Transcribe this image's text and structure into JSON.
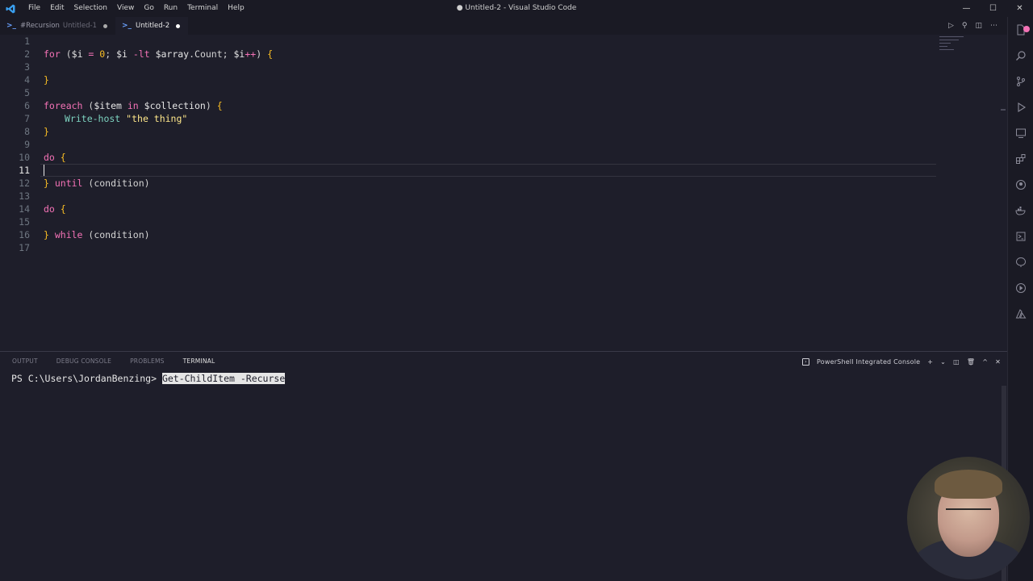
{
  "window": {
    "title": "● Untitled-2 - Visual Studio Code",
    "menu": [
      "File",
      "Edit",
      "Selection",
      "View",
      "Go",
      "Run",
      "Terminal",
      "Help"
    ],
    "controls": [
      "—",
      "☐",
      "✕"
    ]
  },
  "tabs": [
    {
      "icon": ">_",
      "label": "#Recursion",
      "sub": "Untitled-1",
      "active": false
    },
    {
      "icon": ">_",
      "label": "Untitled-2",
      "sub": "",
      "active": true
    }
  ],
  "editor": {
    "current_line": 11,
    "line_numbers": [
      "1",
      "2",
      "3",
      "4",
      "5",
      "6",
      "7",
      "8",
      "9",
      "10",
      "11",
      "12",
      "13",
      "14",
      "15",
      "16",
      "17"
    ]
  },
  "code": {
    "l2": {
      "kw": "for",
      "p1": " (",
      "v1": "$i",
      "op1": " = ",
      "n1": "0",
      "p2": "; ",
      "v2": "$i",
      "op2": " -lt ",
      "v3": "$array",
      "p3": ".Count; ",
      "v4": "$i",
      "op3": "++",
      "p4": ") ",
      "b1": "{"
    },
    "l4": {
      "b": "}"
    },
    "l6": {
      "kw": "foreach",
      "p1": " (",
      "v1": "$item",
      "kw2": " in ",
      "v2": "$collection",
      "p2": ") ",
      "b": "{"
    },
    "l7": {
      "fn": "Write-host",
      "s": " \"the thing\""
    },
    "l8": {
      "b": "}"
    },
    "l10": {
      "kw": "do",
      "b": " {"
    },
    "l12": {
      "b": "} ",
      "kw": "until",
      "rest": " (condition)"
    },
    "l14": {
      "kw": "do",
      "b": " {"
    },
    "l16": {
      "b": "} ",
      "kw": "while",
      "rest": " (condition)"
    }
  },
  "panel": {
    "tabs": [
      "OUTPUT",
      "DEBUG CONSOLE",
      "PROBLEMS",
      "TERMINAL"
    ],
    "active_tab": "TERMINAL",
    "terminal_name": "PowerShell Integrated Console",
    "actions": [
      "+",
      "⌄",
      "◫",
      "🗑",
      "^",
      "✕"
    ]
  },
  "terminal": {
    "prompt": "PS C:\\Users\\JordanBenzing> ",
    "selected_command": "Get-ChildItem -Recurse"
  },
  "colors": {
    "accent": "#f472b6",
    "keyword": "#f472b6",
    "bracket": "#fbbf24",
    "function": "#7dd3c0"
  }
}
